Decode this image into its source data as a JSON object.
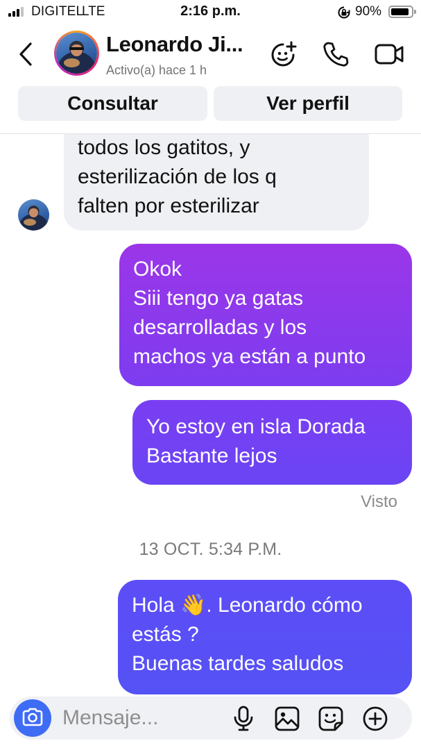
{
  "status_bar": {
    "carrier": "DIGITEL",
    "network": "LTE",
    "time": "2:16 p.m.",
    "battery": "90%",
    "battery_level": 0.9,
    "signal_bars_active": 3,
    "signal_bars_total": 4
  },
  "header": {
    "contact_name": "Leonardo Ji...",
    "contact_status": "Activo(a) hace 1 h",
    "icons": [
      "back-chevron-icon",
      "add-sticker-icon",
      "phone-icon",
      "video-camera-icon"
    ]
  },
  "actions": {
    "consult_label": "Consultar",
    "profile_label": "Ver perfil"
  },
  "messages": [
    {
      "direction": "incoming",
      "lines": [
        "todos los gatitos, y",
        "esterilización de los q",
        "falten por esterilizar"
      ]
    },
    {
      "direction": "outgoing",
      "lines": [
        "Okok",
        "Siii tengo ya gatas",
        "desarrolladas y los",
        "machos ya están a punto"
      ]
    },
    {
      "direction": "outgoing",
      "lines": [
        "Yo estoy en isla Dorada",
        "Bastante lejos"
      ]
    },
    {
      "direction": "outgoing",
      "lines": [
        "Hola 👋. Leonardo cómo",
        "estás ?",
        "Buenas tardes saludos"
      ]
    }
  ],
  "seen_label": "Visto",
  "date_separator": "13 OCT. 5:34 P.M.",
  "composer": {
    "placeholder": "Mensaje...",
    "icons": [
      "camera-icon",
      "microphone-icon",
      "gallery-icon",
      "sticker-icon",
      "plus-circle-icon"
    ]
  },
  "colors": {
    "outgoing_top": "#9b36e8",
    "outgoing_bottom": "#5552f5",
    "incoming_bg": "#eff0f3",
    "camera_button": "#3f6cf5",
    "button_bg": "#eef0f3"
  }
}
